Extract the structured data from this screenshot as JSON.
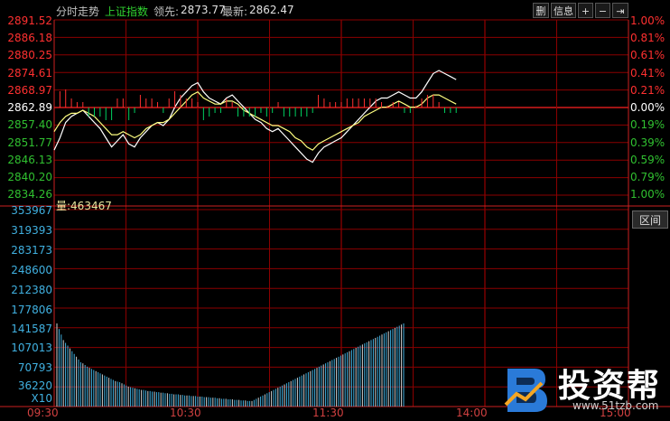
{
  "header": {
    "view_title": "分时走势",
    "index_name": "上证指数",
    "leader_label": "领先:",
    "leader_value": "2873.77",
    "latest_label": "最新:",
    "latest_value": "2862.47",
    "buttons": [
      "删",
      "信息",
      "+",
      "−",
      "⇥"
    ]
  },
  "price_axis_left": [
    "2891.52",
    "2886.18",
    "2880.25",
    "2874.61",
    "2868.97",
    "2862.89",
    "2857.40",
    "2851.77",
    "2846.13",
    "2840.20",
    "2834.26"
  ],
  "price_axis_right": [
    "1.00%",
    "0.81%",
    "0.61%",
    "0.41%",
    "0.21%",
    "0.00%",
    "0.19%",
    "0.39%",
    "0.59%",
    "0.79%",
    "1.00%"
  ],
  "volume_header": {
    "label": "量:",
    "value": "463467"
  },
  "volume_axis": [
    "353967",
    "319393",
    "283173",
    "248600",
    "212380",
    "177806",
    "141587",
    "107013",
    "70793",
    "36220"
  ],
  "volume_multiplier": "X10",
  "time_axis": [
    "09:30",
    "10:30",
    "11:30",
    "14:00",
    "15:00"
  ],
  "side_button": "区间",
  "brand": {
    "name": "投资帮",
    "url": "www.51tzb.com"
  },
  "colors": {
    "up": "#ff3030",
    "down": "#00d060",
    "grid": "#8b0000",
    "axis_text_up": "#ff3030",
    "axis_text_down": "#30c030",
    "neutral": "#ffffff"
  },
  "chart_data": {
    "type": "line",
    "title": "分时走势 上证指数",
    "xlabel": "",
    "ylabel": "",
    "x_ticks": [
      "09:30",
      "10:30",
      "11:30",
      "14:00",
      "15:00"
    ],
    "ylim": [
      2834.26,
      2891.52
    ],
    "series": [
      {
        "name": "最新",
        "values": [
          2849,
          2853,
          2858,
          2860,
          2861,
          2862,
          2860,
          2858,
          2856,
          2853,
          2850,
          2852,
          2854,
          2851,
          2850,
          2853,
          2855,
          2857,
          2858,
          2857,
          2859,
          2863,
          2866,
          2868,
          2870,
          2871,
          2868,
          2866,
          2865,
          2864,
          2866,
          2867,
          2865,
          2863,
          2861,
          2859,
          2858,
          2856,
          2855,
          2856,
          2854,
          2852,
          2850,
          2848,
          2846,
          2845,
          2848,
          2850,
          2851,
          2852,
          2853,
          2855,
          2857,
          2859,
          2861,
          2863,
          2865,
          2866,
          2866,
          2867,
          2868,
          2867,
          2866,
          2866,
          2868,
          2871,
          2874,
          2875,
          2874,
          2873,
          2872
        ]
      },
      {
        "name": "领先",
        "values": [
          2855,
          2858,
          2860,
          2861,
          2861,
          2862,
          2861,
          2860,
          2858,
          2856,
          2854,
          2854,
          2855,
          2854,
          2853,
          2854,
          2856,
          2857,
          2858,
          2858,
          2859,
          2861,
          2863,
          2865,
          2867,
          2868,
          2866,
          2865,
          2864,
          2864,
          2865,
          2865,
          2864,
          2862,
          2861,
          2860,
          2859,
          2858,
          2857,
          2857,
          2856,
          2855,
          2853,
          2852,
          2850,
          2849,
          2851,
          2852,
          2853,
          2854,
          2855,
          2856,
          2857,
          2858,
          2860,
          2861,
          2862,
          2863,
          2863,
          2864,
          2865,
          2864,
          2863,
          2863,
          2864,
          2866,
          2867,
          2867,
          2866,
          2865,
          2864
        ]
      }
    ],
    "volume": [
      150,
      140,
      130,
      120,
      115,
      110,
      105,
      100,
      95,
      90,
      85,
      80,
      78,
      75,
      72,
      70,
      68,
      66,
      64,
      62,
      60,
      58,
      56,
      54,
      52,
      50,
      48,
      46,
      45,
      44,
      42,
      40,
      38,
      36,
      35,
      34,
      33,
      32,
      31,
      30,
      30,
      29,
      28,
      28,
      27,
      27,
      26,
      26,
      25,
      25,
      24,
      24,
      23,
      23,
      22,
      22,
      22,
      21,
      21,
      20,
      20,
      20,
      19,
      19,
      19,
      18,
      18,
      18,
      17,
      17,
      17,
      16,
      16,
      16,
      15,
      15,
      14,
      14,
      14,
      13,
      13,
      13,
      12,
      12,
      12,
      11,
      11,
      11,
      10,
      10,
      10,
      12,
      14,
      16,
      18,
      20,
      22,
      24,
      26,
      28,
      30,
      32,
      34,
      36,
      38,
      40,
      42,
      44,
      46,
      48,
      50,
      52,
      54,
      56,
      58,
      60,
      62,
      64,
      66,
      68,
      70,
      72,
      74,
      76,
      78,
      80,
      82,
      84,
      86,
      88,
      90,
      92,
      94,
      96,
      98,
      100,
      102,
      104,
      106,
      108,
      110,
      112,
      114,
      116,
      118,
      120,
      122,
      124,
      126,
      128,
      130,
      132,
      134,
      136,
      138,
      140,
      142,
      144,
      146,
      148,
      150
    ],
    "volume_ylim": [
      0,
      353967
    ]
  }
}
